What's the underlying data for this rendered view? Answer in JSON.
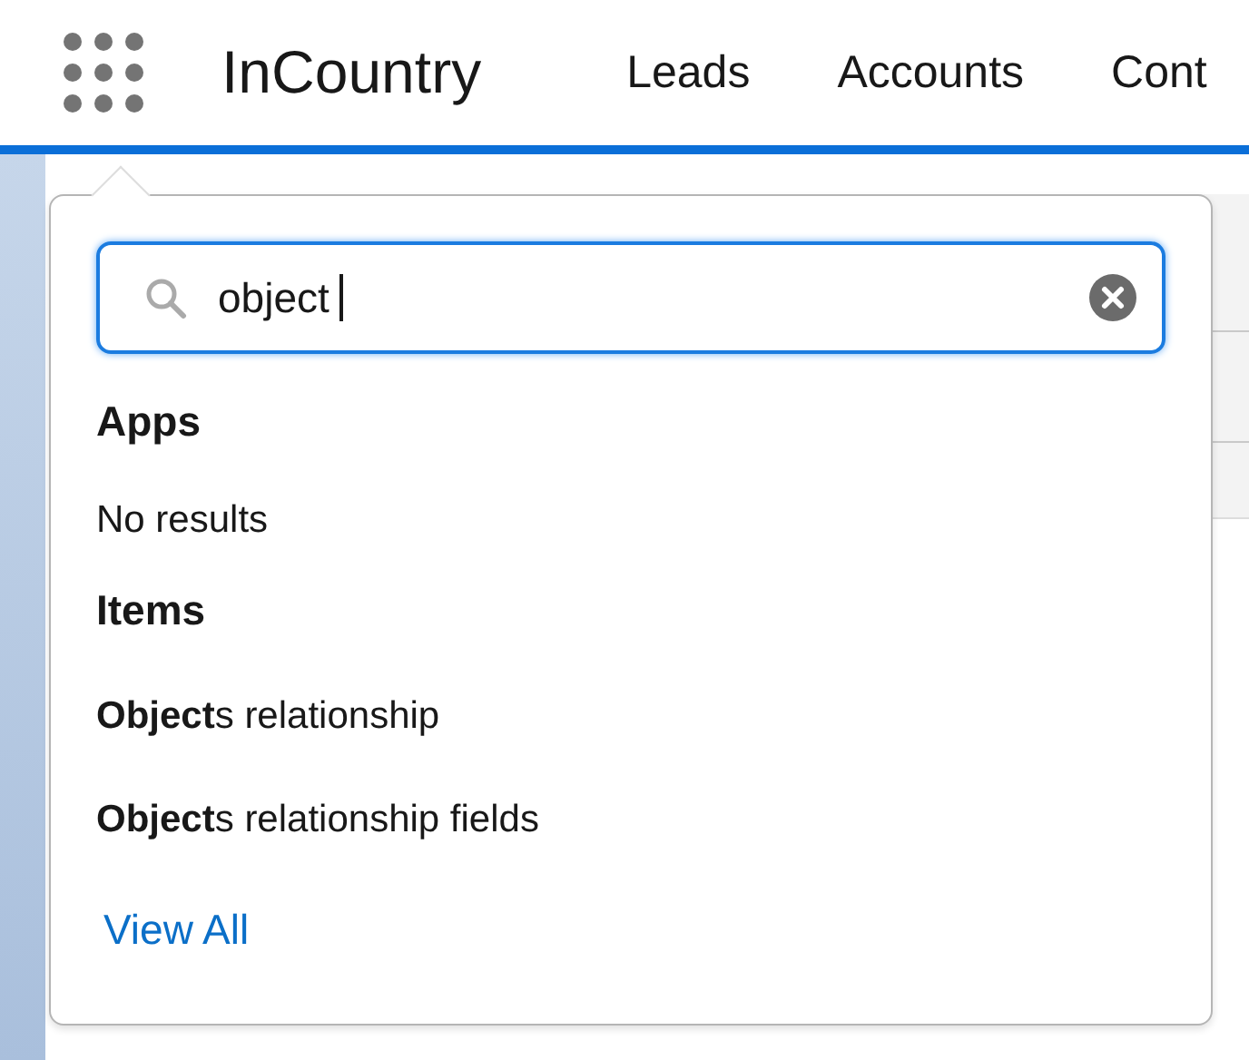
{
  "header": {
    "app_name": "InCountry",
    "nav_items": [
      {
        "label": "Leads"
      },
      {
        "label": "Accounts"
      },
      {
        "label": "Cont"
      }
    ]
  },
  "launcher_popover": {
    "search": {
      "value": "object"
    },
    "sections": [
      {
        "heading": "Apps",
        "empty_text": "No results"
      },
      {
        "heading": "Items",
        "results": [
          {
            "label": "**Object**s relationship"
          },
          {
            "label": "**Object**s relationship fields"
          }
        ]
      }
    ],
    "view_all": "View All"
  }
}
